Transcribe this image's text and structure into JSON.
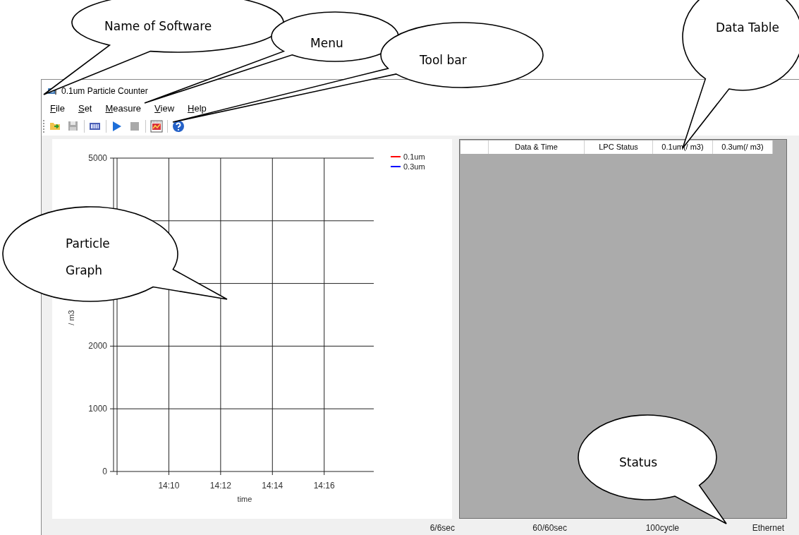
{
  "window": {
    "title": "0.1um Particle Counter"
  },
  "menu": [
    {
      "label": "File",
      "mnemonic": true
    },
    {
      "label": "Set",
      "mnemonic": true
    },
    {
      "label": "Measure",
      "mnemonic": true
    },
    {
      "label": "View",
      "mnemonic": true
    },
    {
      "label": "Help",
      "mnemonic": true
    }
  ],
  "toolbar": [
    {
      "kind": "open",
      "disabled": false
    },
    {
      "kind": "save",
      "disabled": true
    },
    {
      "kind": "separator"
    },
    {
      "kind": "data",
      "disabled": false
    },
    {
      "kind": "separator"
    },
    {
      "kind": "start",
      "disabled": false
    },
    {
      "kind": "stop",
      "disabled": true
    },
    {
      "kind": "separator"
    },
    {
      "kind": "video",
      "disabled": false
    },
    {
      "kind": "separator"
    },
    {
      "kind": "help",
      "disabled": false
    }
  ],
  "graph": {
    "chart_data": {
      "type": "line",
      "grid": true,
      "xlabel": "time",
      "ylabel": "/ m3",
      "ylim": [
        0,
        5000
      ],
      "categories": [
        "14:10",
        "14:12",
        "14:14",
        "14:16"
      ],
      "yticks": [
        0,
        1000,
        2000,
        5000
      ],
      "series": [
        {
          "name": "0.1um",
          "color": "#ff0000",
          "values": [
            null,
            null,
            null,
            null
          ]
        },
        {
          "name": "0.3um",
          "color": "#0000ff",
          "values": [
            null,
            null,
            null,
            null
          ]
        }
      ]
    }
  },
  "data_table": {
    "columns": [
      "Data & Time",
      "LPC Status",
      "0.1um(/ m3)",
      "0.3um(/ m3)"
    ]
  },
  "status_bar": [
    "6/6sec",
    "60/60sec",
    "100cycle",
    "Ethernet"
  ],
  "callouts": [
    {
      "text": "Name of Software"
    },
    {
      "text": "Menu"
    },
    {
      "text": "Tool bar"
    },
    {
      "text": "Data Table"
    },
    {
      "text": "Particle Graph"
    },
    {
      "text": "Status"
    }
  ]
}
